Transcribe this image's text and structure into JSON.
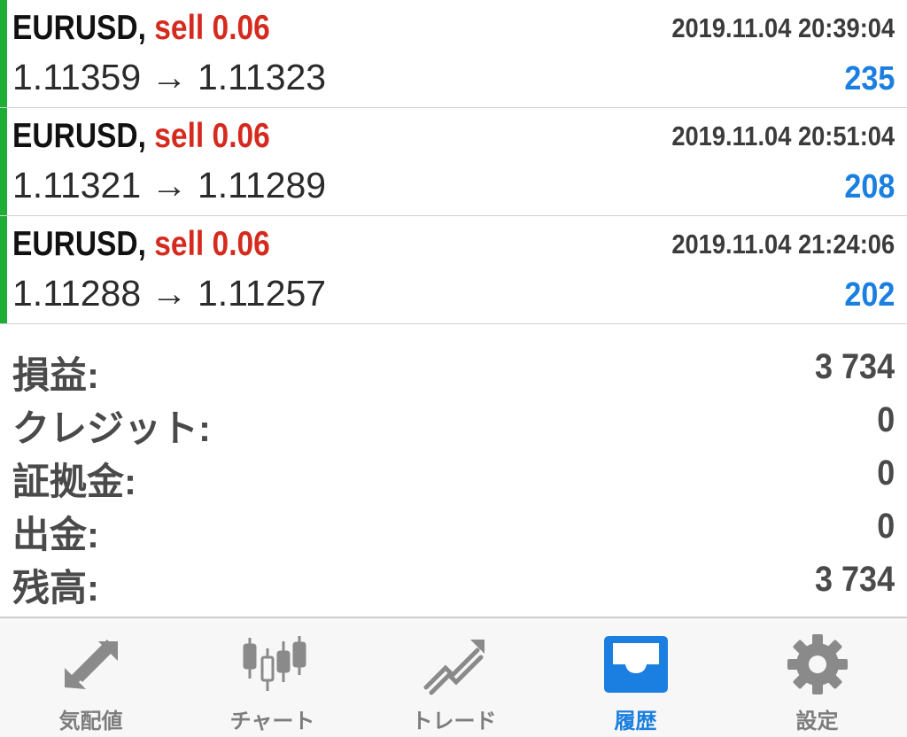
{
  "trades": [
    {
      "symbol": "EURUSD,",
      "side": "sell 0.06",
      "time": "2019.11.04 20:39:04",
      "prices": "1.11359 → 1.11323",
      "profit": "235"
    },
    {
      "symbol": "EURUSD,",
      "side": "sell 0.06",
      "time": "2019.11.04 20:51:04",
      "prices": "1.11321 → 1.11289",
      "profit": "208"
    },
    {
      "symbol": "EURUSD,",
      "side": "sell 0.06",
      "time": "2019.11.04 21:24:06",
      "prices": "1.11288 → 1.11257",
      "profit": "202"
    }
  ],
  "summary": [
    {
      "label": "損益:",
      "value": "3 734"
    },
    {
      "label": "クレジット:",
      "value": "0"
    },
    {
      "label": "証拠金:",
      "value": "0"
    },
    {
      "label": "出金:",
      "value": "0"
    },
    {
      "label": "残高:",
      "value": "3 734"
    }
  ],
  "tabs": [
    {
      "label": "気配値",
      "icon": "quotes-arrows-icon"
    },
    {
      "label": "チャート",
      "icon": "candlestick-chart-icon"
    },
    {
      "label": "トレード",
      "icon": "trade-trend-icon"
    },
    {
      "label": "履歴",
      "icon": "history-inbox-icon",
      "active": true
    },
    {
      "label": "設定",
      "icon": "gear-icon"
    }
  ],
  "colors": {
    "profit_blue": "#1a7fe0",
    "sell_red": "#d52b1e",
    "position_green": "#1fae35",
    "tab_inactive": "#7d7d7d"
  }
}
